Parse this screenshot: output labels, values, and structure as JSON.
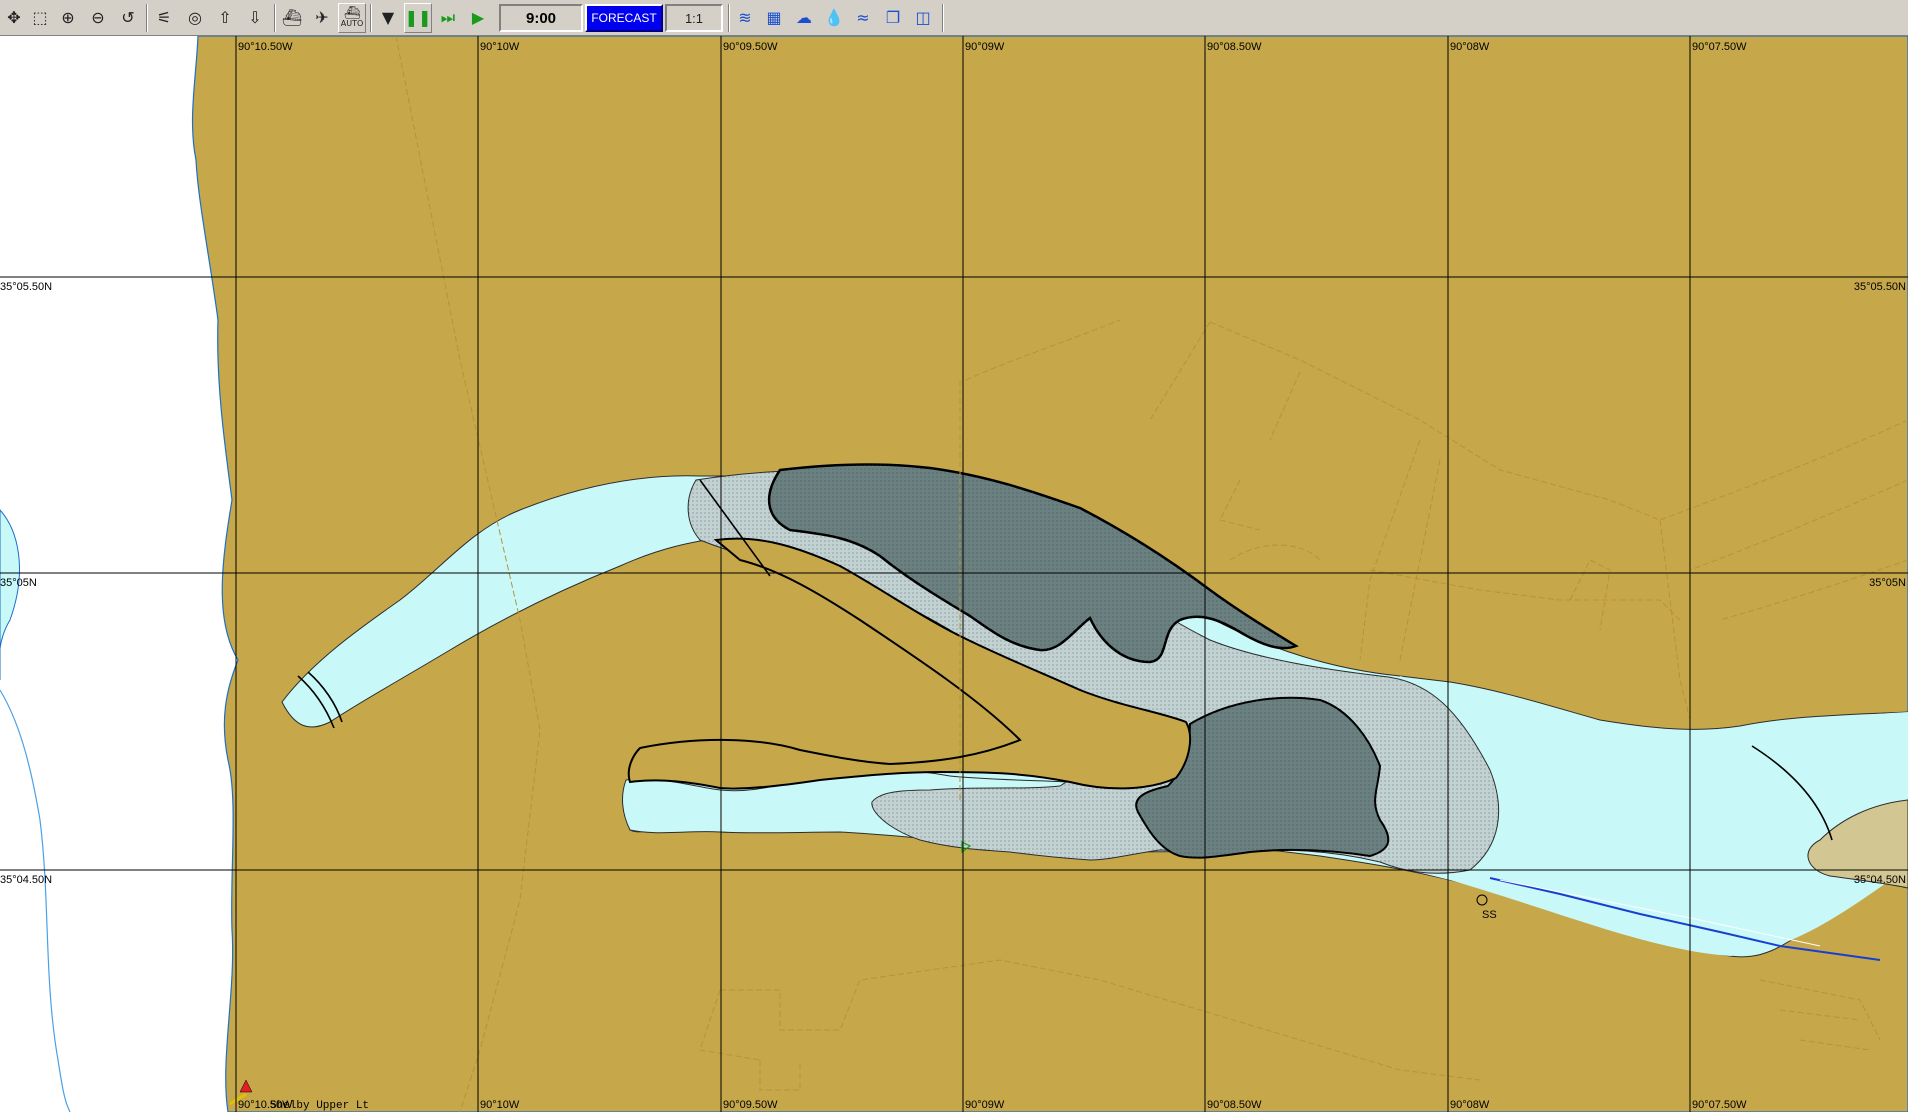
{
  "toolbar": {
    "tools": [
      {
        "name": "pan-tool",
        "glyph": "✥"
      },
      {
        "name": "zoom-window-tool",
        "glyph": "⬚"
      },
      {
        "name": "zoom-in-tool",
        "glyph": "⊕"
      },
      {
        "name": "zoom-out-tool",
        "glyph": "⊖"
      },
      {
        "name": "undo-view-tool",
        "glyph": "↺"
      },
      {
        "name": "measure-tool",
        "glyph": "⚟"
      },
      {
        "name": "target-tool",
        "glyph": "◎"
      },
      {
        "name": "export-tool",
        "glyph": "⇧"
      },
      {
        "name": "import-tool",
        "glyph": "⇩"
      },
      {
        "name": "vessel-tool",
        "glyph": "⛴"
      },
      {
        "name": "aircraft-tool",
        "glyph": "✈"
      }
    ],
    "auto_label": "AUTO",
    "time_value": "9:00",
    "forecast_label": "FORECAST",
    "scale_value": "1:1",
    "layer_tools": [
      {
        "name": "current-layer-tool",
        "glyph": "≋"
      },
      {
        "name": "chart-layer-tool",
        "glyph": "▦"
      },
      {
        "name": "weather-layer-tool",
        "glyph": "☁"
      },
      {
        "name": "water-level-tool",
        "glyph": "💧"
      },
      {
        "name": "wind-layer-tool",
        "glyph": "≈"
      },
      {
        "name": "copy-tool",
        "glyph": "❐"
      },
      {
        "name": "window-tool",
        "glyph": "◫"
      }
    ]
  },
  "map": {
    "colors": {
      "land": "#c6a84b",
      "water": "#c8f8f8",
      "shore_white": "#ffffff",
      "dark_shoal": "#6b8080",
      "light_shoal": "#c2d2d2",
      "flat": "#d2c693",
      "grid": "#000000",
      "road": "#b89238"
    },
    "lon_labels_top": [
      "90°10.50W",
      "90°10W",
      "90°09.50W",
      "90°09W",
      "90°08.50W",
      "90°08W",
      "90°07.50W"
    ],
    "lon_labels_bottom": [
      "90°10.50W",
      "90°10W",
      "90°09.50W",
      "90°09W",
      "90°08.50W",
      "90°08W",
      "90°07.50W"
    ],
    "lat_labels_left": [
      "35°05.50N",
      "35°05N",
      "35°04.50N"
    ],
    "lat_labels_right": [
      "35°05.50N",
      "35°05N",
      "35°04.50N"
    ],
    "symbol_label": "SS",
    "landmark_label": "Shelby Upper Lt"
  }
}
